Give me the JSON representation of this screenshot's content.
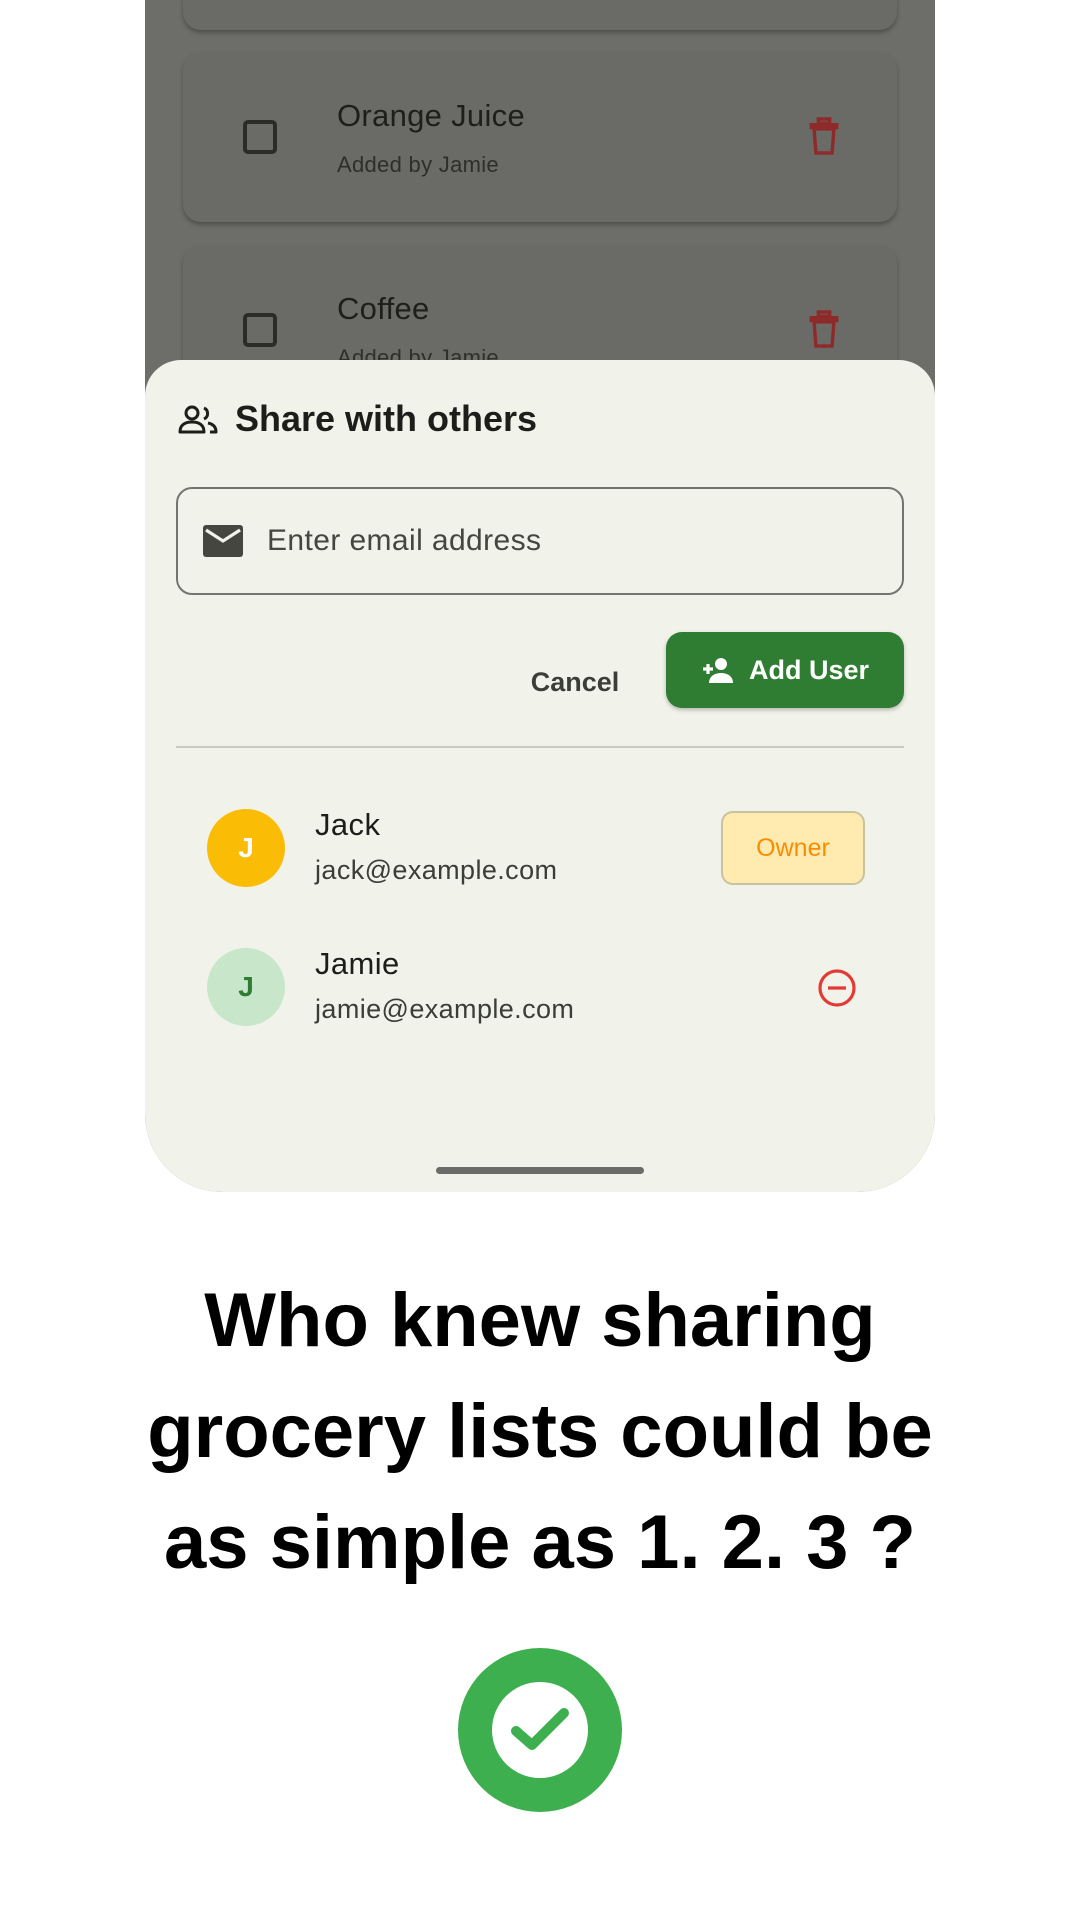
{
  "background_list": {
    "items": [
      {
        "name": "Orange Juice",
        "subtitle": "Added by Jamie",
        "checked": false
      },
      {
        "name": "Coffee",
        "subtitle": "Added by Jamie",
        "checked": false
      }
    ],
    "delete_icon": "trash-icon",
    "delete_color": "#c62828"
  },
  "share_sheet": {
    "title": "Share with others",
    "title_icon": "people-icon",
    "email_input": {
      "placeholder": "Enter email address",
      "value": "",
      "icon": "mail-icon"
    },
    "cancel_label": "Cancel",
    "add_user_label": "Add User",
    "add_user_icon": "person-add-icon",
    "users": [
      {
        "initial": "J",
        "name": "Jack",
        "email": "jack@example.com",
        "role": "Owner"
      },
      {
        "initial": "J",
        "name": "Jamie",
        "email": "jamie@example.com",
        "remove_icon": "remove-circle-icon"
      }
    ]
  },
  "tagline": {
    "line1": "Who knew sharing",
    "line2": "grocery lists could be",
    "line3": "as simple as 1. 2. 3 ?"
  },
  "badge_icon": "check-circle-icon",
  "colors": {
    "primary": "#2e7d32",
    "owner_avatar": "#fbbc05",
    "owner_badge_bg": "#ffebb0",
    "owner_badge_text": "#fb8c00",
    "remove": "#e53935",
    "check_badge": "#3daf4f"
  }
}
